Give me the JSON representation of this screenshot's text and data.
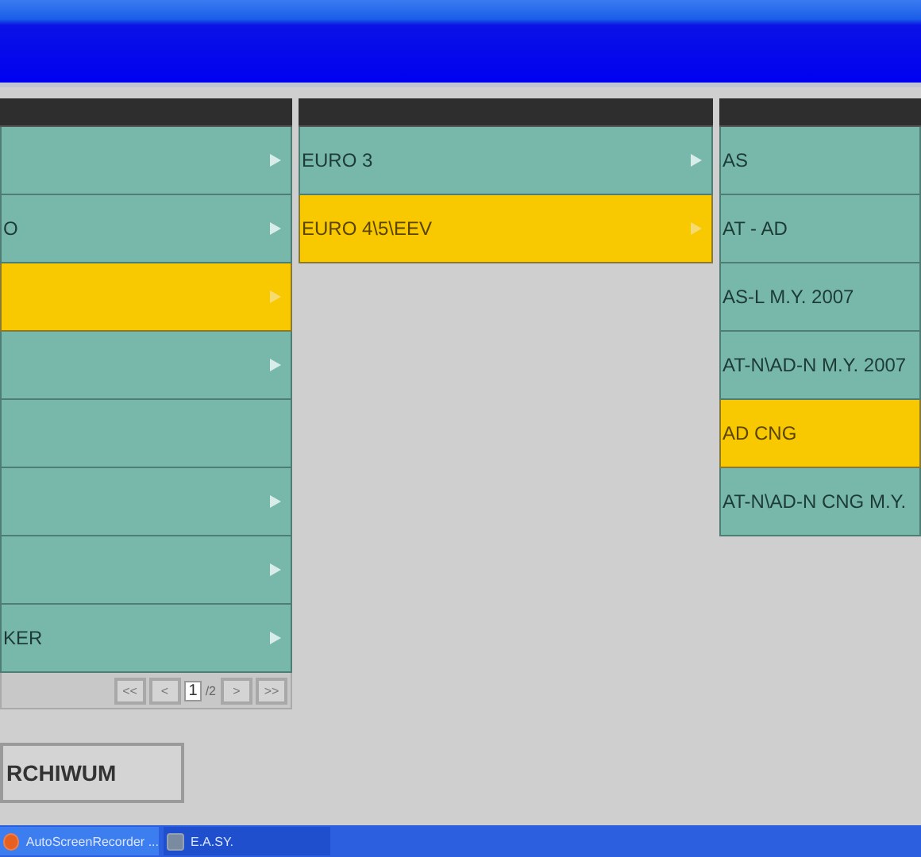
{
  "columns": [
    {
      "rows": [
        {
          "arrow": true,
          "selected": false
        },
        {
          "label": "O",
          "arrow": true,
          "selected": false
        },
        {
          "arrow": true,
          "selected": true
        },
        {
          "arrow": true,
          "selected": false
        },
        {
          "arrow": false,
          "selected": false
        },
        {
          "arrow": true,
          "selected": false
        },
        {
          "arrow": true,
          "selected": false
        },
        {
          "label": "KER",
          "arrow": true,
          "selected": false
        }
      ],
      "pager": {
        "buttons": [
          "<<",
          "<"
        ],
        "page": "1",
        "total": "/2",
        "next": [
          ">",
          ">>"
        ]
      }
    },
    {
      "rows": [
        {
          "label": "EURO 3",
          "arrow": true,
          "selected": false
        },
        {
          "label": "EURO 4\\5\\EEV",
          "arrow": true,
          "selected": true
        }
      ]
    },
    {
      "rows": [
        {
          "label": "AS",
          "arrow": false,
          "selected": false
        },
        {
          "label": "AT - AD",
          "arrow": false,
          "selected": false
        },
        {
          "label": "AS-L M.Y. 2007",
          "arrow": false,
          "selected": false
        },
        {
          "label": "AT-N\\AD-N M.Y. 2007",
          "arrow": false,
          "selected": false
        },
        {
          "label": "AD CNG",
          "arrow": false,
          "selected": true
        },
        {
          "label": "AT-N\\AD-N CNG M.Y.",
          "arrow": false,
          "selected": false
        }
      ]
    }
  ],
  "archive_button": "RCHIWUM",
  "taskbar": [
    {
      "label": "AutoScreenRecorder ...",
      "active": true
    },
    {
      "label": "E.A.SY.",
      "active": false
    }
  ]
}
